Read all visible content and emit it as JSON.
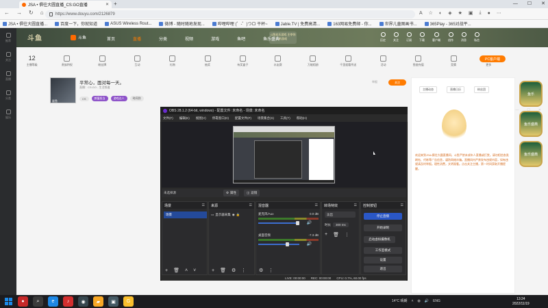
{
  "browser": {
    "tab_title": "JSA • 俱往大圆直播_CS:GO直播",
    "url": "https://www.douyu.com/2126879",
    "window_controls": [
      "—",
      "☐",
      "✕"
    ],
    "bookmarks": [
      "JSA • 俱往大圆直播...",
      "百度一下，你就知道",
      "ASUS Wireless Rout...",
      "微博 - 随时随地发现...",
      "哔哩哔哩 (゜-゜)つロ 干杯~",
      "Jable.TV | 免费高清...",
      "163网易免费邮 - 你...",
      "世界儿童图画书...",
      "365Play - 365对战平..."
    ]
  },
  "site": {
    "logo": "斗鱼",
    "logo_sub": "斗鱼",
    "nav": [
      "首页",
      "直播",
      "分类",
      "视频",
      "游戏",
      "鱼吧",
      "鱼乐盛典"
    ],
    "nav_active": "直播",
    "promo": "斗鱼欢乐游戏 主宰你的游戏",
    "user_icons": [
      "历史",
      "关注",
      "订阅",
      "下载",
      "客户端",
      "创作",
      "消息",
      "私信"
    ],
    "left_sidebar": [
      "推荐",
      "关注",
      "直播",
      "分类",
      "娱乐"
    ],
    "subnav": [
      {
        "label": "主播等级",
        "value": "12"
      },
      {
        "label": "贵族特权"
      },
      {
        "label": "粉丝牌"
      },
      {
        "label": "互动"
      },
      {
        "label": "礼物"
      },
      {
        "label": "抽奖"
      },
      {
        "label": "有奖盒子"
      },
      {
        "label": "水友赛"
      },
      {
        "label": "万能相册"
      },
      {
        "label": "千里遥看传送"
      },
      {
        "label": "活动"
      },
      {
        "label": "鱼翅充值"
      },
      {
        "label": "竞猜"
      },
      {
        "label": "更多"
      }
    ],
    "pc_button": "PC客户端",
    "room_title": "平常心，面对每一天。",
    "room_meta": "直播：CS:GO - 生活频道",
    "avatar_name": "鲨鱼",
    "tags": [
      "CS",
      "颜值担当",
      "游戏达人",
      "时间到"
    ],
    "follow": "关注",
    "report": "举报",
    "right_tabs": [
      "主播动态",
      "直播日历",
      "粉丝团"
    ],
    "notice": "欢迎来到JSA•俱往大圆直播间，斗鱼严禁未成年人直播或打赏。请勿相信各类刷钻、代练等广告信息，谨防网络诈骗。直播间内严禁发布违规内容，如有违规请及时举报。理性消费，文明观看。点击关注主播，第一时间获取开播提醒。",
    "side_images": [
      "鱼乐",
      "鱼乐盛典",
      "鱼乐盛典"
    ]
  },
  "obs": {
    "title": "OBS 28.1.2 (64-bit, windows) - 配置文件: 未命名 - 场景: 未命名",
    "menu": [
      "文件(F)",
      "编辑(E)",
      "视图(V)",
      "停靠窗口(D)",
      "配置文件(P)",
      "场景集合(S)",
      "工具(T)",
      "帮助(H)"
    ],
    "window_controls": [
      "—",
      "☐",
      "✕"
    ],
    "no_source": "未选择源",
    "props_btn": "属性",
    "filter_btn": "滤镜",
    "docks": {
      "scenes": {
        "title": "场景",
        "items": [
          "场景"
        ]
      },
      "sources": {
        "title": "来源",
        "items": [
          "显示器采集"
        ]
      },
      "mixer": {
        "title": "混音器",
        "channels": [
          {
            "name": "麦克风/Aux",
            "db": "0.0 dB"
          },
          {
            "name": "桌面音频",
            "db": "-7.3 dB"
          }
        ]
      },
      "transitions": {
        "title": "转场特效",
        "type": "淡出",
        "duration_label": "时长",
        "duration": "300 ms"
      },
      "controls": {
        "title": "控制按钮",
        "buttons": [
          "停止直播",
          "开始录制",
          "启动虚拟摄像机",
          "工作室模式",
          "设置",
          "退出"
        ]
      }
    },
    "status": {
      "live": "LIVE: 00:00:00",
      "rec": "REC: 00:00:00",
      "cpu": "CPU: 0.7%, 60.00 fps"
    }
  },
  "taskbar": {
    "weather": "14°C 晴朗",
    "time": "13:24",
    "date": "2022/11/19",
    "lang": "ENG"
  }
}
